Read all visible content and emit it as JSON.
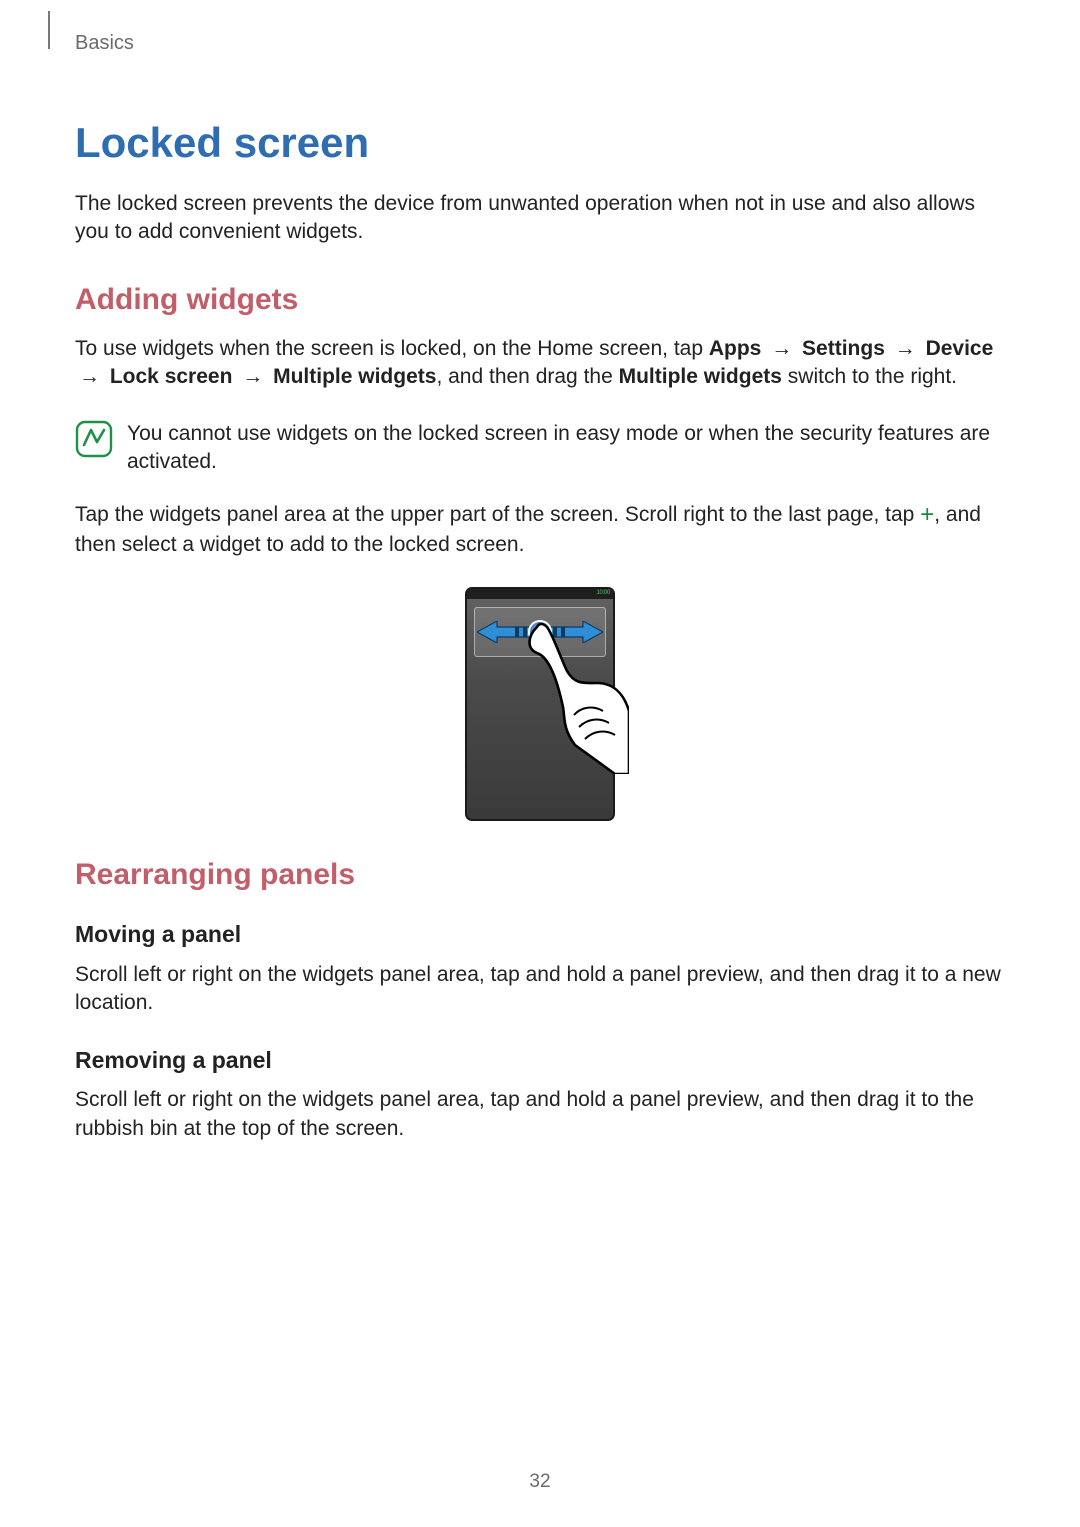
{
  "breadcrumb": "Basics",
  "title": "Locked screen",
  "intro": "The locked screen prevents the device from unwanted operation when not in use and also allows you to add convenient widgets.",
  "sec1": {
    "heading": "Adding widgets",
    "p1_a": "To use widgets when the screen is locked, on the Home screen, tap ",
    "p1_b_apps": "Apps",
    "p1_arrow": "→",
    "p1_b_settings": "Settings",
    "p1_b_device": "Device",
    "p1_b_lock": "Lock screen",
    "p1_b_multi": "Multiple widgets",
    "p1_c": ", and then drag the ",
    "p1_d_multi2": "Multiple widgets",
    "p1_e": " switch to the right.",
    "note": "You cannot use widgets on the locked screen in easy mode or when the security features are activated.",
    "p2_a": "Tap the widgets panel area at the upper part of the screen. Scroll right to the last page, tap ",
    "p2_plus": "+",
    "p2_b": ", and then select a widget to add to the locked screen."
  },
  "figure": {
    "status_time": "10:00"
  },
  "sec2": {
    "heading": "Rearranging panels",
    "sub1_heading": "Moving a panel",
    "sub1_body": "Scroll left or right on the widgets panel area, tap and hold a panel preview, and then drag it to a new location.",
    "sub2_heading": "Removing a panel",
    "sub2_body": "Scroll left or right on the widgets panel area, tap and hold a panel preview, and then drag it to the rubbish bin at the top of the screen."
  },
  "page_number": "32"
}
